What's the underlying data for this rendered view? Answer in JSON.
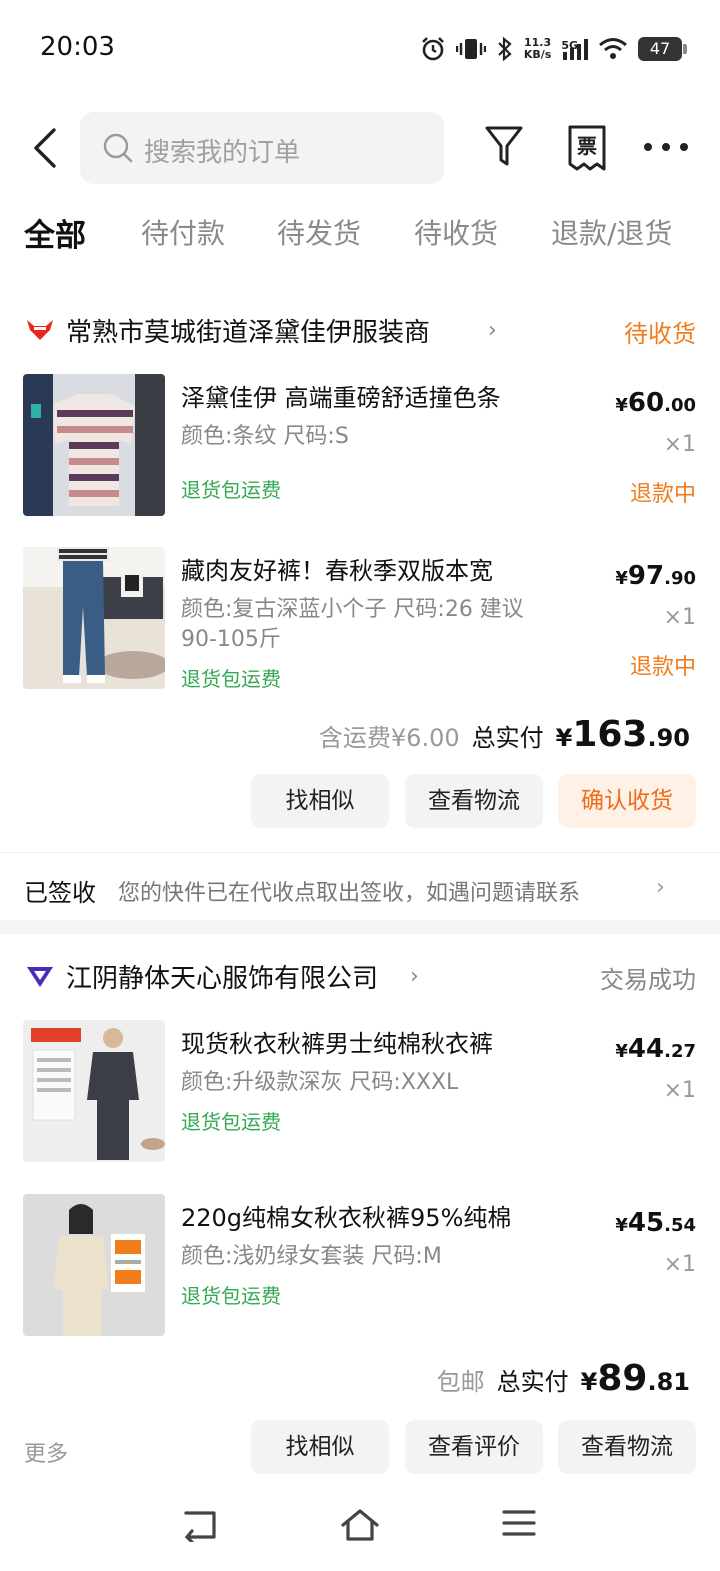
{
  "status_bar": {
    "time": "20:03",
    "net_speed_value": "11.3",
    "net_speed_unit": "KB/s",
    "network": "5G",
    "battery": "47"
  },
  "search": {
    "placeholder": "搜索我的订单"
  },
  "tabs": [
    {
      "label": "全部",
      "active": true
    },
    {
      "label": "待付款"
    },
    {
      "label": "待发货"
    },
    {
      "label": "待收货"
    },
    {
      "label": "退款/退货"
    }
  ],
  "orders": [
    {
      "shop": "常熟市莫城街道泽黛佳伊服装商",
      "status": "待收货",
      "status_color": "#f07c1c",
      "items": [
        {
          "title": "泽黛佳伊 高端重磅舒适撞色条",
          "spec": "颜色:条纹 尺码:S",
          "return_tag": "退货包运费",
          "price_yen": "¥",
          "price_int": "60",
          "price_dec": ".00",
          "qty": "×1",
          "refund": "退款中"
        },
        {
          "title": "藏肉友好裤！春秋季双版本宽",
          "spec": "颜色:复古深蓝小个子 尺码:26 建议90-105斤",
          "return_tag": "退货包运费",
          "price_yen": "¥",
          "price_int": "97",
          "price_dec": ".90",
          "qty": "×1",
          "refund": "退款中"
        }
      ],
      "shipping": "含运费¥6.00",
      "total_label": "总实付",
      "total_yen": "¥",
      "total_int": "163",
      "total_dec": ".90",
      "buttons": [
        "找相似",
        "查看物流",
        "确认收货"
      ],
      "logistics_title": "已签收",
      "logistics_desc": "您的快件已在代收点取出签收，如遇问题请联系"
    },
    {
      "shop": "江阴静体天心服饰有限公司",
      "status": "交易成功",
      "status_color": "#888888",
      "items": [
        {
          "title": "现货秋衣秋裤男士纯棉秋衣裤",
          "spec": "颜色:升级款深灰 尺码:XXXL",
          "return_tag": "退货包运费",
          "price_yen": "¥",
          "price_int": "44",
          "price_dec": ".27",
          "qty": "×1"
        },
        {
          "title": "220g纯棉女秋衣秋裤95%纯棉",
          "spec": "颜色:浅奶绿女套装 尺码:M",
          "return_tag": "退货包运费",
          "price_yen": "¥",
          "price_int": "45",
          "price_dec": ".54",
          "qty": "×1"
        }
      ],
      "shipping": "包邮",
      "total_label": "总实付",
      "total_yen": "¥",
      "total_int": "89",
      "total_dec": ".81",
      "buttons": [
        "找相似",
        "查看评价",
        "查看物流"
      ],
      "more": "更多"
    }
  ],
  "colors": {
    "accent": "#f06b1a",
    "green": "#34a853",
    "tmall_red": "#e8261f",
    "brand_purple": "#4b2bb8"
  }
}
